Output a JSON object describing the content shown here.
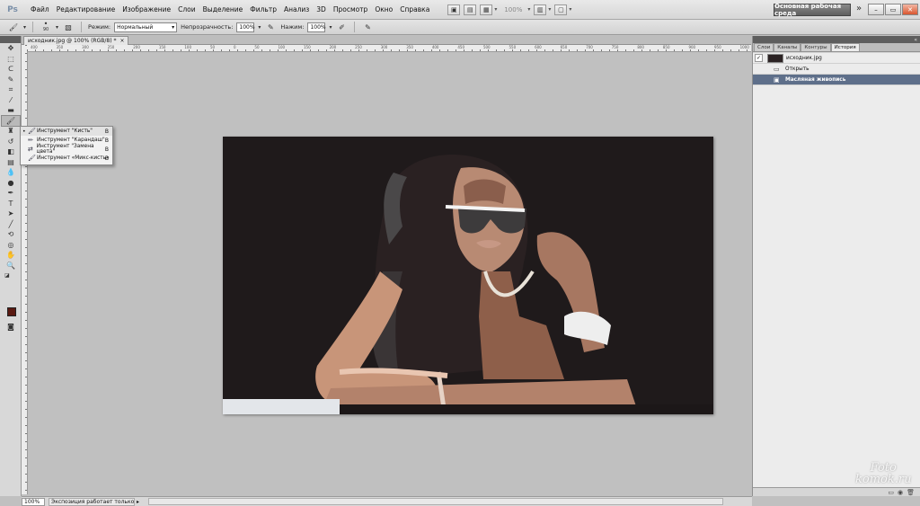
{
  "app": {
    "logo": "Ps"
  },
  "menu": [
    "Файл",
    "Редактирование",
    "Изображение",
    "Слои",
    "Выделение",
    "Фильтр",
    "Анализ",
    "3D",
    "Просмотр",
    "Окно",
    "Справка"
  ],
  "menubar": {
    "zoom": "100%",
    "workspace": "Основная рабочая среда",
    "more": "»"
  },
  "options": {
    "brush_size": "90",
    "mode_label": "Режим:",
    "mode_value": "Нормальный",
    "opacity_label": "Непрозрачность:",
    "opacity_value": "100%",
    "pressure_label": "Нажим:",
    "pressure_value": "100%"
  },
  "document": {
    "tab_title": "исходник.jpg @ 100% (RGB/8) *",
    "close": "×"
  },
  "ruler": [
    "400",
    "350",
    "300",
    "250",
    "200",
    "150",
    "100",
    "50",
    "0",
    "50",
    "100",
    "150",
    "200",
    "250",
    "300",
    "350",
    "400",
    "450",
    "500",
    "550",
    "600",
    "650",
    "700",
    "750",
    "800",
    "850",
    "900",
    "950",
    "1000"
  ],
  "flyout": [
    {
      "label": "Инструмент \"Кисть\"",
      "key": "B",
      "icon": "brush-icon",
      "selected": true
    },
    {
      "label": "Инструмент \"Карандаш\"",
      "key": "B",
      "icon": "pencil-icon",
      "selected": false
    },
    {
      "label": "Инструмент \"Замена цвета\"",
      "key": "B",
      "icon": "color-replace-icon",
      "selected": false
    },
    {
      "label": "Инструмент «Микс-кисть»",
      "key": "B",
      "icon": "mixer-brush-icon",
      "selected": false
    }
  ],
  "panel": {
    "tabs": [
      "Слои",
      "Каналы",
      "Контуры",
      "История"
    ],
    "history": [
      {
        "label": "исходник.jpg",
        "kind": "snapshot"
      },
      {
        "label": "Открыть",
        "kind": "step"
      },
      {
        "label": "Масляная живопись",
        "kind": "step",
        "selected": true
      }
    ]
  },
  "status": {
    "zoom": "100%",
    "info": "Экспозиция работает только в ..."
  },
  "watermark": {
    "line1": "Foto",
    "line2": "komok.ru"
  },
  "colors": {
    "foreground": "#5a1a12",
    "background": "#ffffff",
    "selection": "#5e6f8a"
  }
}
